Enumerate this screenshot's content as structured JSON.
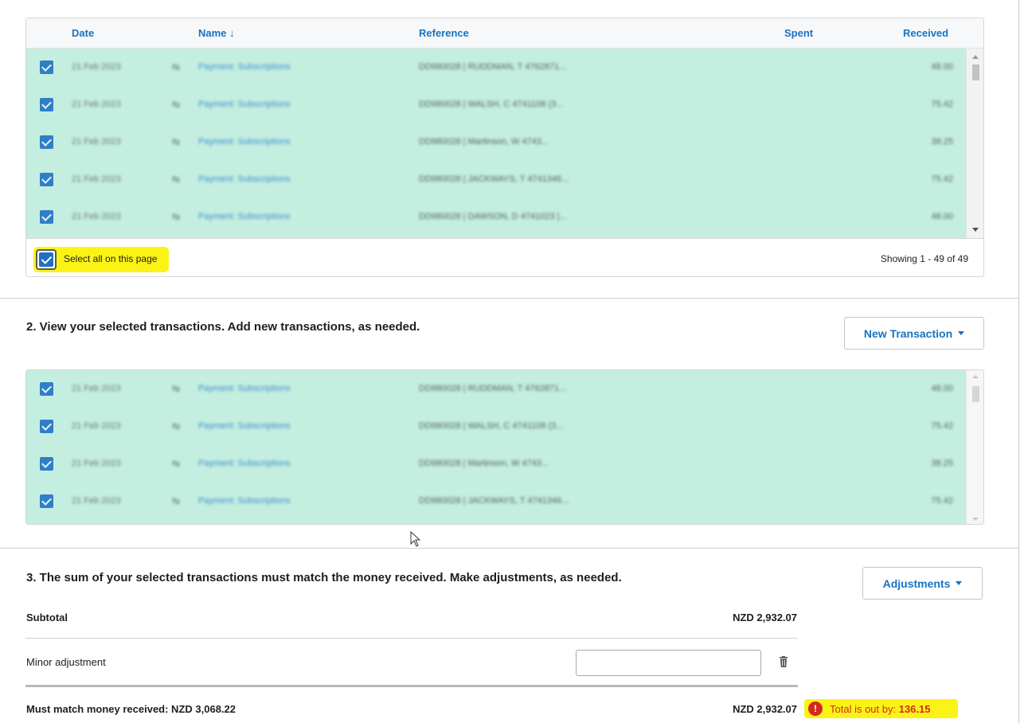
{
  "table": {
    "columns": {
      "date": "Date",
      "name": "Name ↓",
      "reference": "Reference",
      "spent": "Spent",
      "received": "Received"
    },
    "rows": [
      {
        "date": "21 Feb 2023",
        "name": "Payment: Subscriptions",
        "reference": "DD980028 | RUDDMAN, T 4762871...",
        "received": "48.00"
      },
      {
        "date": "21 Feb 2023",
        "name": "Payment: Subscriptions",
        "reference": "DD980028 | WALSH, C 4741108 (3...",
        "received": "75.42"
      },
      {
        "date": "21 Feb 2023",
        "name": "Payment: Subscriptions",
        "reference": "DD980028 | Martinson, W 4743...",
        "received": "38.25"
      },
      {
        "date": "21 Feb 2023",
        "name": "Payment: Subscriptions",
        "reference": "DD980028 | JACKWAYS, T 4741346...",
        "received": "75.42"
      },
      {
        "date": "21 Feb 2023",
        "name": "Payment: Subscriptions",
        "reference": "DD980028 | DAWSON, D 4741023 |...",
        "received": "48.00"
      }
    ],
    "select_all_label": "Select all on this page",
    "showing": "Showing 1 - 49 of 49",
    "icon": "transfer-icon"
  },
  "section2": {
    "title": "2. View your selected transactions. Add new transactions, as needed.",
    "new_transaction_label": "New Transaction",
    "rows": [
      {
        "date": "21 Feb 2023",
        "name": "Payment: Subscriptions",
        "reference": "DD980028 | RUDDMAN, T 4762871...",
        "received": "48.00"
      },
      {
        "date": "21 Feb 2023",
        "name": "Payment: Subscriptions",
        "reference": "DD980028 | WALSH, C 4741108 (3...",
        "received": "75.42"
      },
      {
        "date": "21 Feb 2023",
        "name": "Payment: Subscriptions",
        "reference": "DD980028 | Martinson, W 4743...",
        "received": "38.25"
      },
      {
        "date": "21 Feb 2023",
        "name": "Payment: Subscriptions",
        "reference": "DD980028 | JACKWAYS, T 4741346...",
        "received": "75.42"
      }
    ]
  },
  "section3": {
    "title": "3. The sum of your selected transactions must match the money received. Make adjustments, as needed.",
    "adjustments_label": "Adjustments",
    "subtotal_label": "Subtotal",
    "subtotal_value": "NZD 2,932.07",
    "minor_adjustment_label": "Minor adjustment",
    "minor_adjustment_value": "",
    "must_match_label": "Must match money received: NZD 3,068.22",
    "total_value": "NZD 2,932.07",
    "out_by_label": "Total is out by: ",
    "out_by_value": "136.15"
  },
  "colors": {
    "selected_row_bg": "#c4eedf",
    "link_blue": "#1773c2",
    "highlight_yellow": "#fbf316",
    "error_red": "#d7281f"
  }
}
